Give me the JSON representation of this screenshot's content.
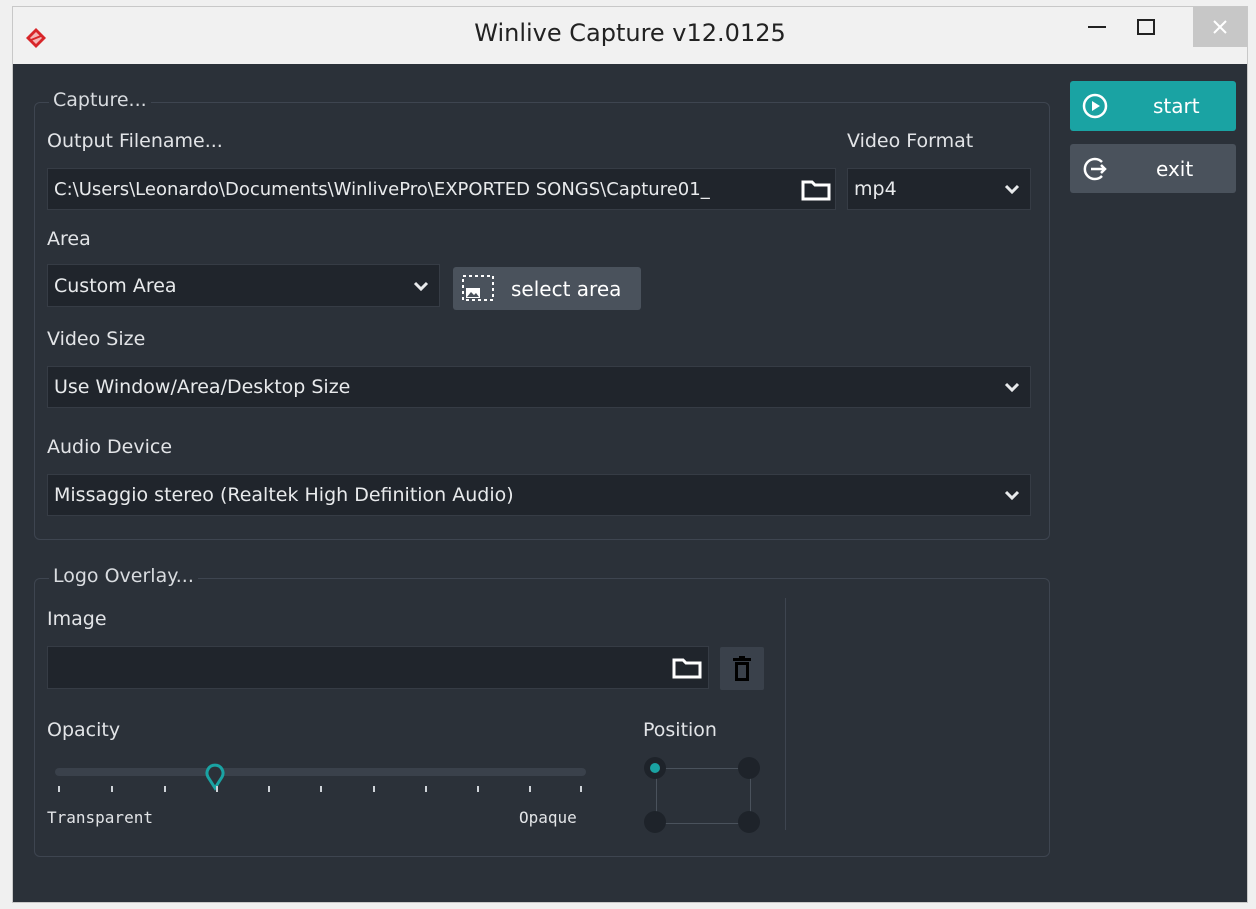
{
  "window": {
    "title": "Winlive Capture v12.0125"
  },
  "capture": {
    "legend": "Capture...",
    "output_label": "Output Filename...",
    "output_value": "C:\\Users\\Leonardo\\Documents\\WinlivePro\\EXPORTED SONGS\\Capture01_",
    "format_label": "Video Format",
    "format_value": "mp4",
    "area_label": "Area",
    "area_value": "Custom Area",
    "select_area_label": "select area",
    "size_label": "Video Size",
    "size_value": "Use Window/Area/Desktop Size",
    "audio_label": "Audio Device",
    "audio_value": "Missaggio stereo (Realtek High Definition Audio)"
  },
  "logo": {
    "legend": "Logo Overlay...",
    "image_label": "Image",
    "image_value": "",
    "opacity_label": "Opacity",
    "opacity_min_label": "Transparent",
    "opacity_max_label": "Opaque",
    "opacity_fraction": 0.3,
    "position_label": "Position",
    "position_selected": "top-left"
  },
  "actions": {
    "start_label": "start",
    "exit_label": "exit"
  },
  "colors": {
    "accent": "#1aa3a3",
    "exit_bg": "#4a525c",
    "background": "#2b3139"
  }
}
